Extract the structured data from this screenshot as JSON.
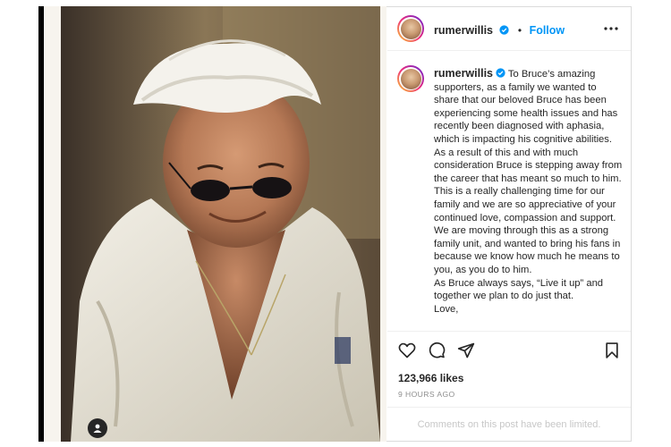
{
  "post": {
    "photo_icon": "person-tag-icon",
    "header": {
      "username": "rumerwillis",
      "separator": "•",
      "follow_label": "Follow",
      "more_icon": "more-options-icon"
    },
    "caption": {
      "username": "rumerwillis",
      "paragraphs": [
        "To Bruce’s amazing supporters, as a family we wanted to share that our beloved Bruce has been experiencing some health issues and has recently been diagnosed with aphasia, which is impacting his cognitive abilities. As a result of this and with much consideration Bruce is stepping away from the career that has meant so much to him.",
        "This is a really challenging time for our family and we are so appreciative of your continued love, compassion and support. We are moving through this as a strong family unit, and wanted to bring his fans in because we know how much he means to you, as you do to him.",
        "As Bruce always says, “Live it up” and together we plan to do just that.",
        "Love,"
      ]
    },
    "actions": {
      "icons": [
        "heart-icon",
        "comment-icon",
        "share-icon",
        "bookmark-icon"
      ],
      "likes": "123,966 likes",
      "timestamp": "9 HOURS AGO"
    },
    "comments_notice": "Comments on this post have been limited."
  },
  "colors": {
    "link_blue": "#0095f6",
    "verified_blue": "#0095f6",
    "text": "#262626",
    "muted": "#8e8e8e",
    "border": "#dbdbdb"
  }
}
